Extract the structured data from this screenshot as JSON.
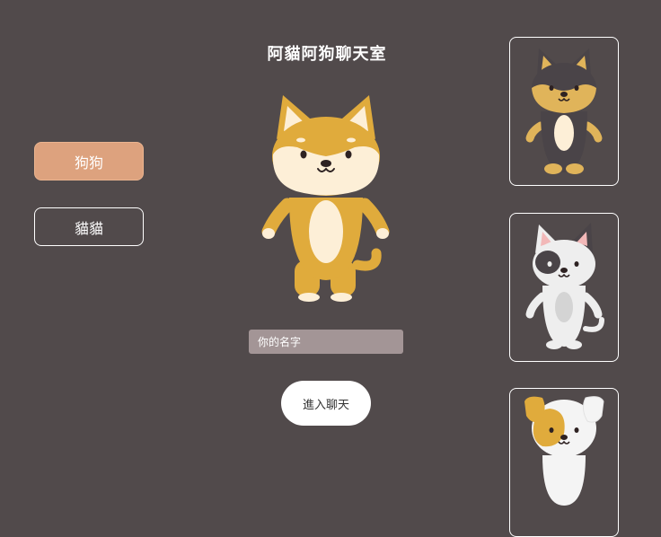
{
  "page": {
    "title": "阿貓阿狗聊天室"
  },
  "side_buttons": {
    "dog": "狗狗",
    "cat": "貓貓",
    "selected": "dog"
  },
  "form": {
    "name_placeholder": "你的名字",
    "name_value": "",
    "enter_label": "進入聊天"
  },
  "avatars": [
    {
      "name": "black-tan-dog-avatar"
    },
    {
      "name": "white-gray-spotted-cat-avatar"
    },
    {
      "name": "white-orange-puppy-avatar"
    }
  ],
  "colors": {
    "background": "#514a4b",
    "selected_button": "#dda27e",
    "input_background": "#a39596",
    "shiba_orange": "#e0ab3c",
    "shiba_cream": "#fdefd7"
  }
}
